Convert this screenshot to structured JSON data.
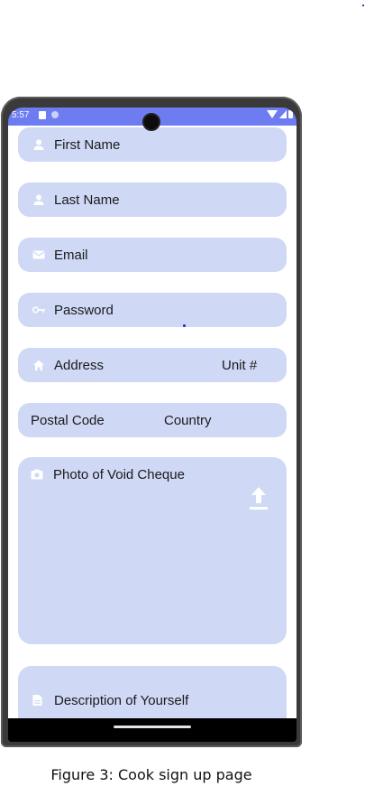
{
  "status_bar": {
    "time": "5:57"
  },
  "form": {
    "first_name": "First Name",
    "last_name": "Last Name",
    "email": "Email",
    "password": "Password",
    "address": "Address",
    "unit": "Unit #",
    "postal_code": "Postal Code",
    "country": "Country",
    "photo_label": "Photo of Void Cheque",
    "description": "Description of Yourself"
  },
  "icons": {
    "first_name": "person-icon",
    "last_name": "person-icon",
    "email": "envelope-icon",
    "password": "key-icon",
    "address": "home-icon",
    "photo": "camera-icon",
    "upload": "upload-icon",
    "description": "document-icon"
  },
  "colors": {
    "status_bar": "#6d7cf0",
    "field_bg": "#cfd8f5",
    "icon": "#ffffff"
  },
  "caption": "Figure 3: Cook sign up page"
}
